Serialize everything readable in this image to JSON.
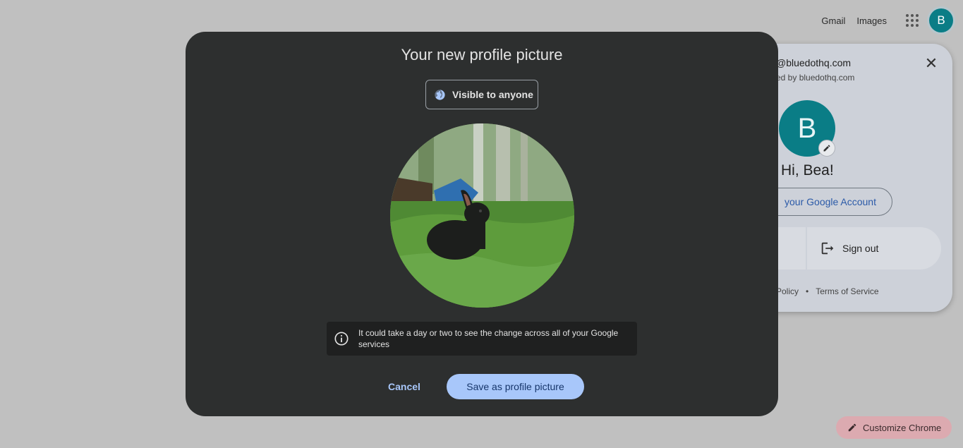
{
  "topbar": {
    "gmail": "Gmail",
    "images": "Images",
    "apps_icon": "apps-grid-icon",
    "avatar_initial": "B"
  },
  "account_card": {
    "email": "@bluedothq.com",
    "managed_by": "ed by bluedothq.com",
    "avatar_initial": "B",
    "greeting": "Hi, Bea!",
    "manage_account": "your Google Account",
    "sign_out": "Sign out",
    "privacy": "Policy",
    "terms": "Terms of Service",
    "footer_separator": "•"
  },
  "modal": {
    "title": "Your new profile picture",
    "visibility": "Visible to anyone",
    "notice": "It could take a day or two to see the change across all of your Google services",
    "cancel": "Cancel",
    "save": "Save as profile picture"
  },
  "customize_chrome": "Customize Chrome",
  "colors": {
    "accent": "#a8c7fa",
    "avatar": "#0a7d86",
    "modal_bg": "#2d2f2f"
  }
}
